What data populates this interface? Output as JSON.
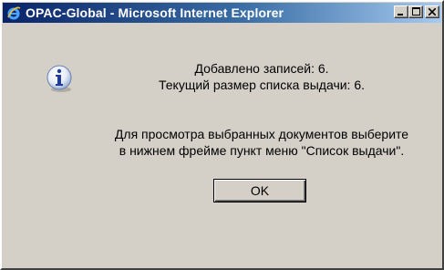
{
  "window": {
    "title": "OPAC-Global - Microsoft Internet Explorer"
  },
  "titlebar_buttons": {
    "minimize_icon": "minimize-icon",
    "maximize_icon": "maximize-icon",
    "close_icon": "close-icon"
  },
  "dialog": {
    "icon": "info-icon",
    "line1": "Добавлено записей: 6.",
    "line2": "Текущий размер списка выдачи: 6.",
    "line3": "Для просмотра выбранных документов выберите",
    "line4": "в нижнем фрейме пункт меню \"Список выдачи\".",
    "ok_label": "OK"
  },
  "colors": {
    "titlebar_start": "#0a246a",
    "titlebar_end": "#a6caf0",
    "face": "#d4d0c8"
  }
}
